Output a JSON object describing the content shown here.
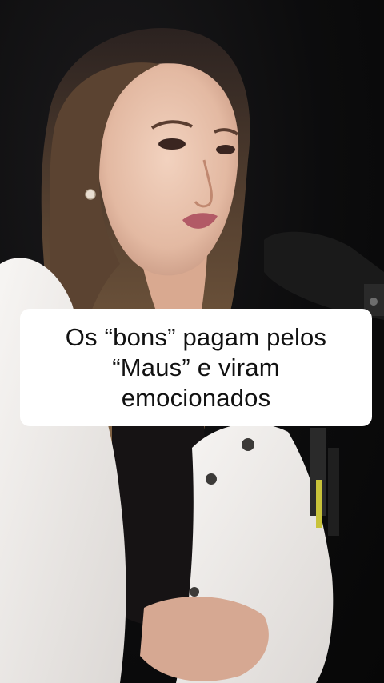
{
  "video": {
    "caption": "Os “bons” pagam pelos\n“Maus” e viram\nemocionados"
  },
  "colors": {
    "caption_background": "#ffffff",
    "caption_text": "#111111",
    "background": "#0b0b0c"
  }
}
